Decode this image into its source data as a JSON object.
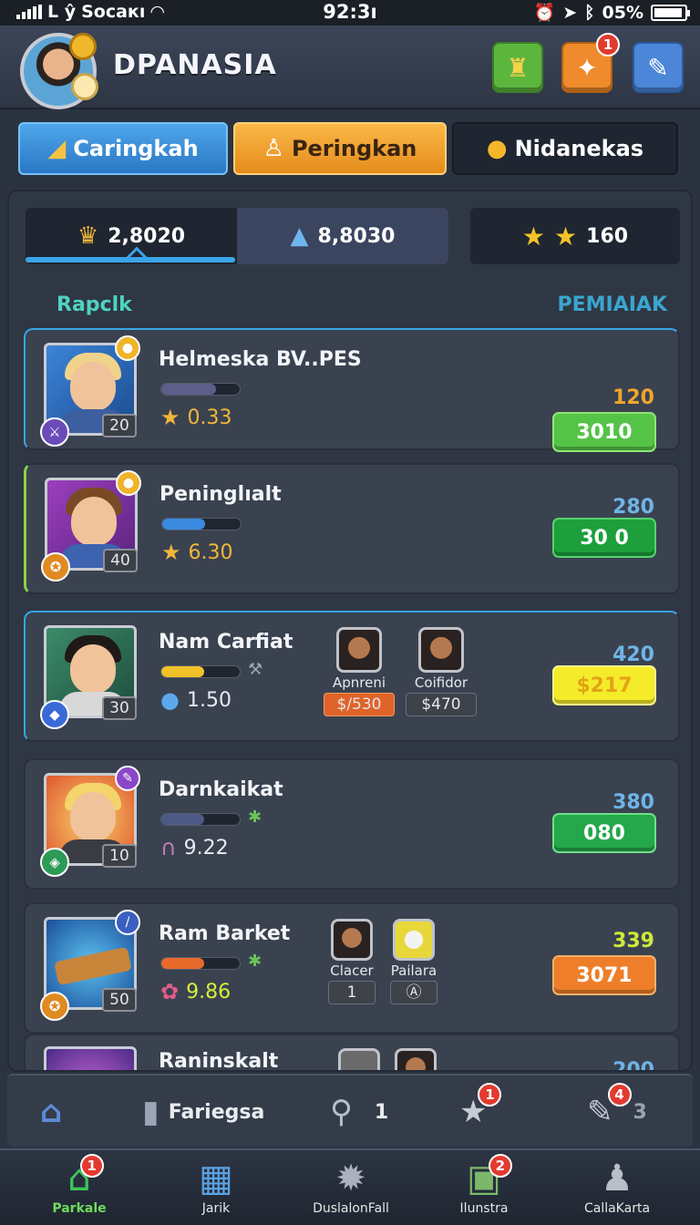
{
  "status_bar": {
    "carrier": "Socaкı",
    "time": "92:3ı",
    "battery": "05%"
  },
  "header": {
    "title": "DPANASIA",
    "badge_count": "1"
  },
  "top_tabs": [
    {
      "label": "Caringkah",
      "icon": "bell-icon"
    },
    {
      "label": "Peringkan",
      "icon": "person-icon"
    },
    {
      "label": "Nidanekas",
      "icon": "coin-icon"
    }
  ],
  "scores": {
    "seg1": "2,8020",
    "seg2": "8,8030",
    "stars": "160"
  },
  "list_header": {
    "left": "Rapclk",
    "right": "PEMIAIAK"
  },
  "players": [
    {
      "name": "Helmeska BV..PES",
      "level": "20",
      "stat": "0.33",
      "points": "120",
      "value": "3010",
      "bar_pct": 0.7
    },
    {
      "name": "Peninglıalt",
      "level": "40",
      "stat": "6.30",
      "points": "280",
      "value": "30 0",
      "bar_pct": 0.55
    },
    {
      "name": "Nam Carfiat",
      "level": "30",
      "stat": "1.50",
      "points": "420",
      "value": "$217",
      "bar_pct": 0.55,
      "minis": [
        {
          "name": "Apnreni",
          "chip": "$/530"
        },
        {
          "name": "Coifidor",
          "chip": "$470"
        }
      ]
    },
    {
      "name": "Darnkaikat",
      "level": "10",
      "stat": "9.22",
      "points": "380",
      "value": "080",
      "bar_pct": 0.55
    },
    {
      "name": "Ram Barket",
      "level": "50",
      "stat": "9.86",
      "points": "339",
      "value": "3071",
      "bar_pct": 0.55,
      "minis": [
        {
          "name": "Clacer",
          "chip": "1"
        },
        {
          "name": "Pailara",
          "chip": "Ⓐ"
        }
      ]
    },
    {
      "name": "Raninskalt",
      "points": "200"
    }
  ],
  "toolbar": {
    "label": "Fariegsa",
    "count1": "1",
    "count2": "3",
    "badge1": "1",
    "badge2": "4"
  },
  "bottom_nav": [
    {
      "label": "Parkale",
      "badge": "1"
    },
    {
      "label": "Jarik",
      "badge": ""
    },
    {
      "label": "DuslalonFall",
      "badge": ""
    },
    {
      "label": "Ilunstra",
      "badge": "2"
    },
    {
      "label": "CallaKarta",
      "badge": ""
    }
  ]
}
